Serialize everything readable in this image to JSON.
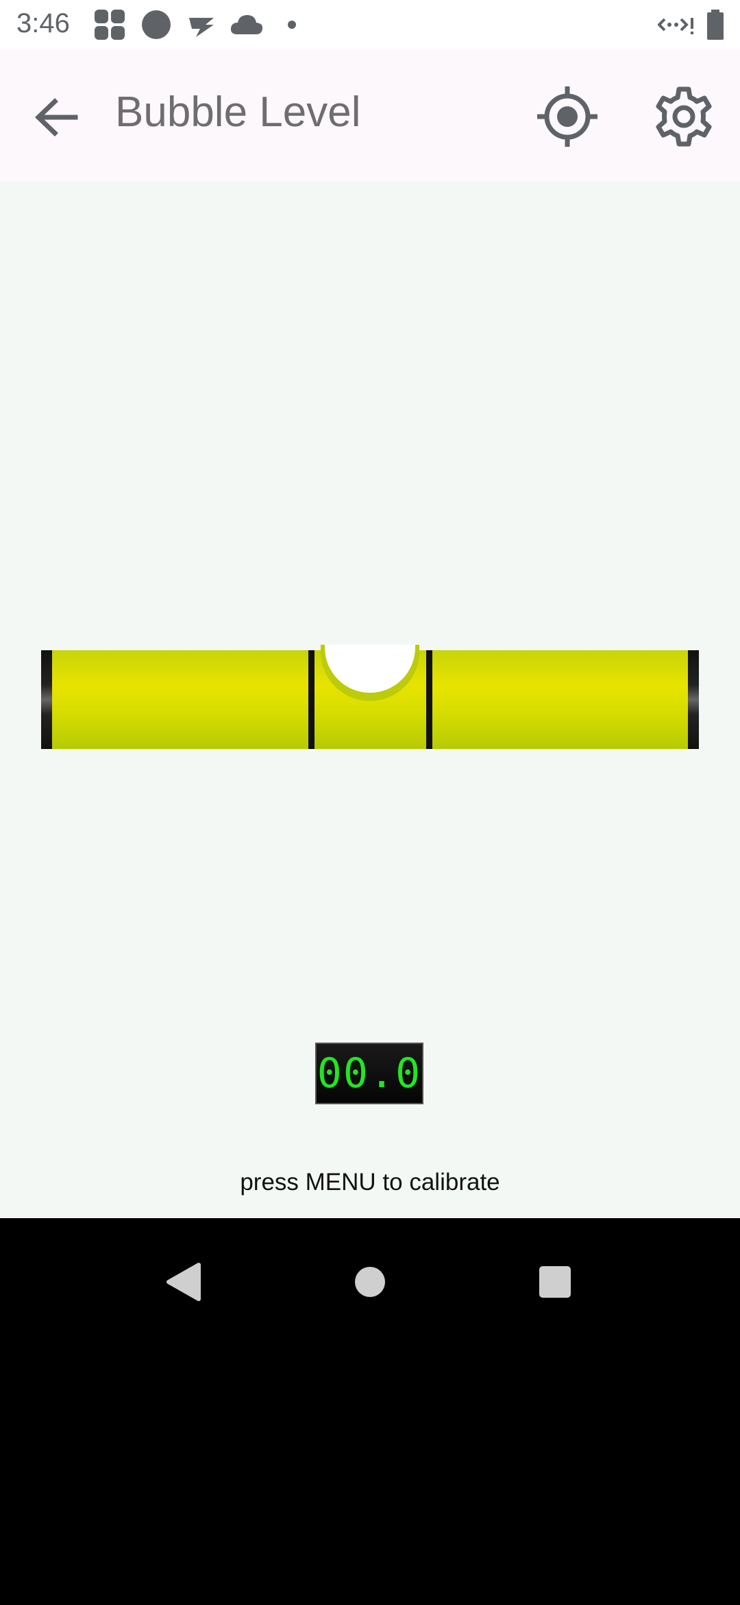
{
  "status_bar": {
    "time": "3:46",
    "icons": [
      "app-grid-icon",
      "circle-icon",
      "wifi-off-icon",
      "cloud-icon",
      "dot-icon",
      "signal-icon",
      "battery-icon"
    ]
  },
  "app_bar": {
    "title": "Bubble Level",
    "back_icon": "arrow-back-icon",
    "actions": [
      "target-icon",
      "gear-icon"
    ]
  },
  "level": {
    "angle_readout": "00.0",
    "hint": "press MENU to calibrate",
    "colors": {
      "liquid": "#e7e300",
      "bubble": "#ffffff",
      "digits": "#22e622"
    }
  },
  "nav_bar": {
    "buttons": [
      "back-triangle-icon",
      "home-circle-icon",
      "recents-square-icon"
    ]
  }
}
